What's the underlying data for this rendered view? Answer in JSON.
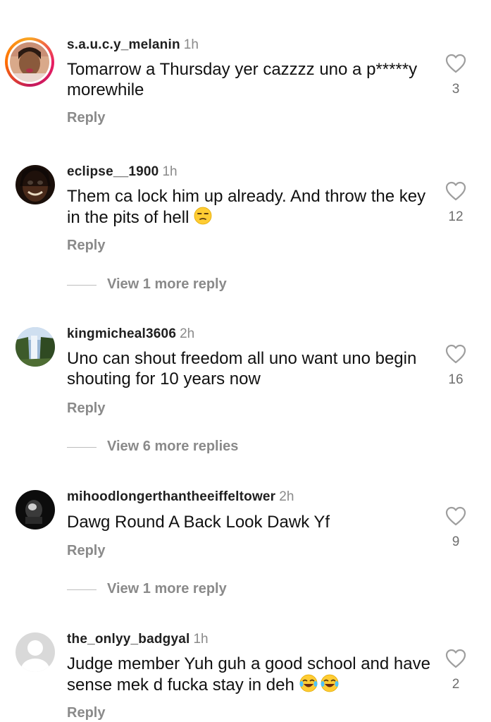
{
  "comments": [
    {
      "username": "s.a.u.c.y_melanin",
      "time": "1h",
      "text": "Tomarrow a Thursday yer cazzzz uno a p*****y morewhile",
      "likes": "3",
      "reply": "Reply"
    },
    {
      "username": "eclipse__1900",
      "time": "1h",
      "text": "Them ca lock him up already. And throw the key in the pits of hell",
      "emoji": "unamused-face",
      "likes": "12",
      "reply": "Reply",
      "view_more": "View 1 more reply"
    },
    {
      "username": "kingmicheal3606",
      "time": "2h",
      "text": "Uno can shout freedom all uno want uno begin shouting for 10 years now",
      "likes": "16",
      "reply": "Reply",
      "view_more": "View 6 more replies"
    },
    {
      "username": "mihoodlongerthantheeiffeltower",
      "time": "2h",
      "text": "Dawg Round A Back Look Dawk Yf",
      "likes": "9",
      "reply": "Reply",
      "view_more": "View 1 more reply"
    },
    {
      "username": "the_onlyy_badgyal",
      "time": "1h",
      "text": "Judge member Yuh guh a good school and have sense mek d fucka stay in deh",
      "emoji": "laughing-tears",
      "likes": "2",
      "reply": "Reply"
    }
  ],
  "colors": {
    "text": "#111111",
    "muted": "#8a8a8a",
    "heart": "#9e9e9e"
  }
}
